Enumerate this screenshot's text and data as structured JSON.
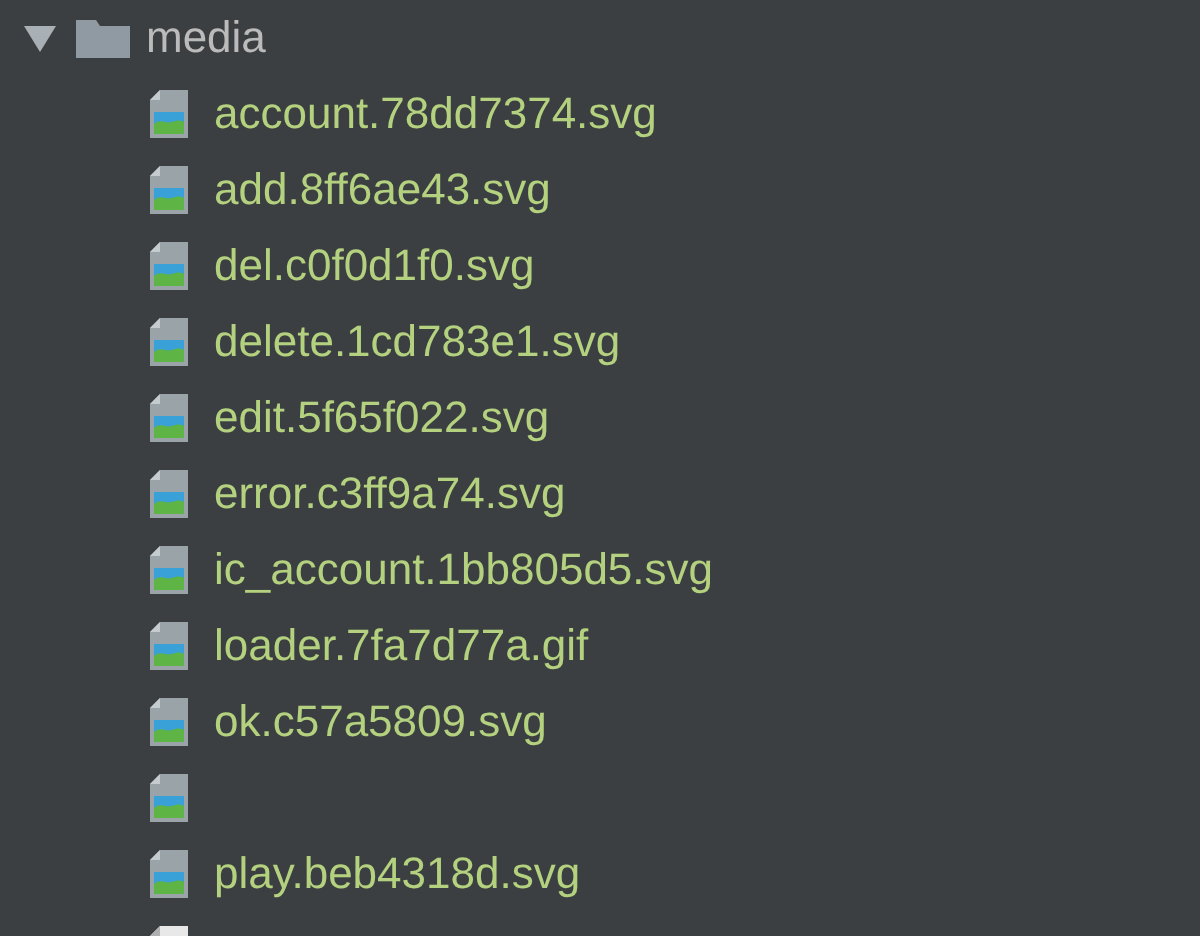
{
  "tree": [
    {
      "kind": "folder",
      "name": "media",
      "expanded": true,
      "children": [
        {
          "kind": "image",
          "name": "account.78dd7374.svg"
        },
        {
          "kind": "image",
          "name": "add.8ff6ae43.svg"
        },
        {
          "kind": "image",
          "name": "del.c0f0d1f0.svg"
        },
        {
          "kind": "image",
          "name": "delete.1cd783e1.svg"
        },
        {
          "kind": "image",
          "name": "edit.5f65f022.svg"
        },
        {
          "kind": "image",
          "name": "error.c3ff9a74.svg"
        },
        {
          "kind": "image",
          "name": "ic_account.1bb805d5.svg"
        },
        {
          "kind": "image",
          "name": "loader.7fa7d77a.gif"
        },
        {
          "kind": "image",
          "name": "ok.c57a5809.svg"
        },
        {
          "kind": "image"
        },
        {
          "kind": "image",
          "name": "play.beb4318d.svg"
        },
        {
          "kind": "document"
        }
      ]
    }
  ]
}
